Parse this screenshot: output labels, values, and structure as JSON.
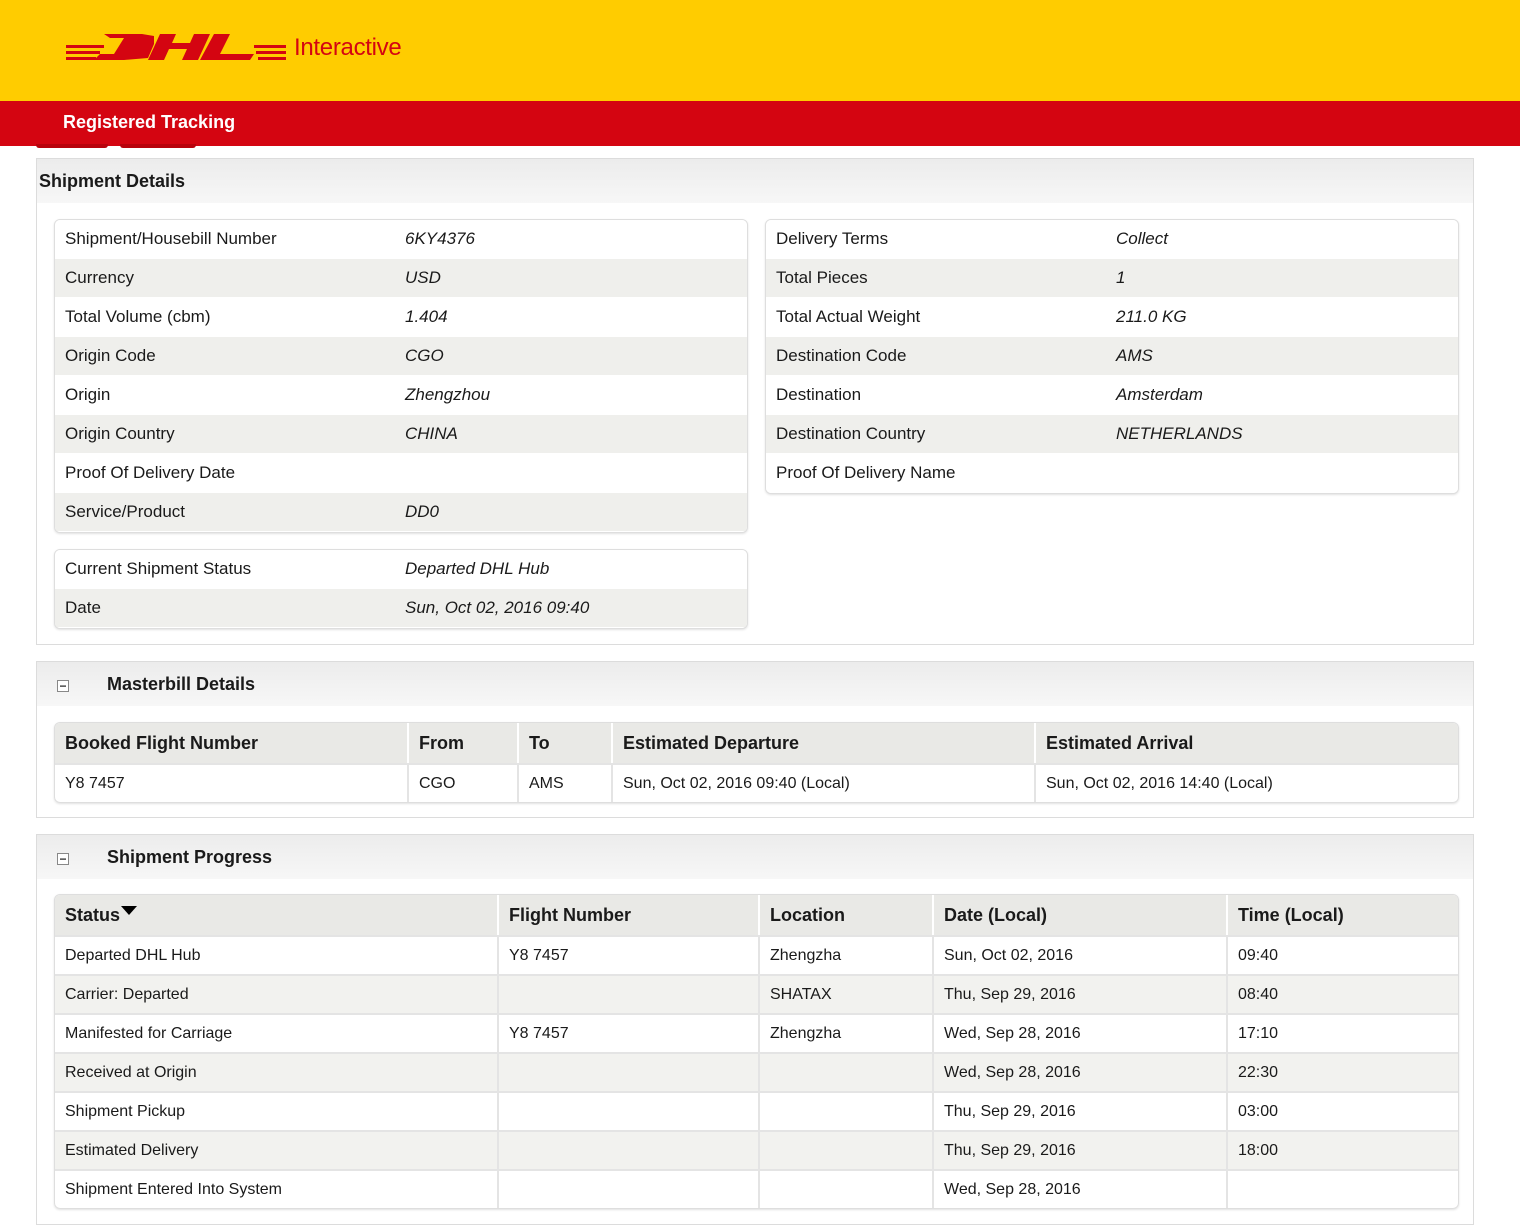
{
  "brand": {
    "logo_text": "Interactive",
    "colors": {
      "yellow": "#ffcc00",
      "red": "#d40511"
    }
  },
  "nav": {
    "title": "Registered Tracking"
  },
  "shipment_details": {
    "heading": "Shipment Details",
    "left": [
      {
        "label": "Shipment/Housebill Number",
        "value": "6KY4376"
      },
      {
        "label": "Currency",
        "value": "USD"
      },
      {
        "label": "Total Volume (cbm)",
        "value": "1.404"
      },
      {
        "label": "Origin Code",
        "value": "CGO"
      },
      {
        "label": "Origin",
        "value": "Zhengzhou"
      },
      {
        "label": "Origin Country",
        "value": "CHINA"
      },
      {
        "label": "Proof Of Delivery Date",
        "value": ""
      },
      {
        "label": "Service/Product",
        "value": "DD0"
      }
    ],
    "right": [
      {
        "label": "Delivery Terms",
        "value": "Collect"
      },
      {
        "label": "Total Pieces",
        "value": "1"
      },
      {
        "label": "Total Actual Weight",
        "value": "211.0 KG"
      },
      {
        "label": "Destination Code",
        "value": "AMS"
      },
      {
        "label": "Destination",
        "value": "Amsterdam"
      },
      {
        "label": "Destination Country",
        "value": "NETHERLANDS"
      },
      {
        "label": "Proof Of Delivery Name",
        "value": ""
      }
    ],
    "status": [
      {
        "label": "Current Shipment Status",
        "value": "Departed DHL Hub"
      },
      {
        "label": "Date",
        "value": "Sun, Oct 02, 2016 09:40"
      }
    ]
  },
  "masterbill": {
    "heading": "Masterbill Details",
    "toggle": "−",
    "columns": [
      "Booked Flight Number",
      "From",
      "To",
      "Estimated Departure",
      "Estimated Arrival"
    ],
    "rows": [
      [
        "Y8 7457",
        "CGO",
        "AMS",
        "Sun, Oct 02, 2016 09:40 (Local)",
        "Sun, Oct 02, 2016 14:40 (Local)"
      ]
    ]
  },
  "progress": {
    "heading": "Shipment Progress",
    "toggle": "−",
    "columns": [
      "Status",
      "Flight Number",
      "Location",
      "Date (Local)",
      "Time (Local)"
    ],
    "rows": [
      [
        "Departed DHL Hub",
        "Y8 7457",
        "Zhengzha",
        "Sun, Oct 02, 2016",
        "09:40"
      ],
      [
        "Carrier: Departed",
        "",
        "SHATAX",
        "Thu, Sep 29, 2016",
        "08:40"
      ],
      [
        "Manifested for Carriage",
        "Y8 7457",
        "Zhengzha",
        "Wed, Sep 28, 2016",
        "17:10"
      ],
      [
        "Received at Origin",
        "",
        "",
        "Wed, Sep 28, 2016",
        "22:30"
      ],
      [
        "Shipment Pickup",
        "",
        "",
        "Thu, Sep 29, 2016",
        "03:00"
      ],
      [
        "Estimated Delivery",
        "",
        "",
        "Thu, Sep 29, 2016",
        "18:00"
      ],
      [
        "Shipment Entered Into System",
        "",
        "",
        "Wed, Sep 28, 2016",
        ""
      ]
    ]
  }
}
